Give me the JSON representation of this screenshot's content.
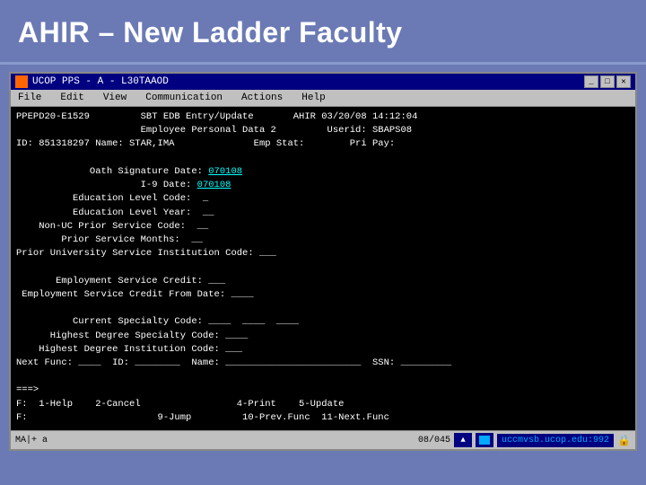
{
  "header": {
    "title": "AHIR – New Ladder Faculty"
  },
  "window": {
    "titlebar": "UCOP PPS - A - L30TAAOD",
    "icon": "app-icon"
  },
  "menubar": {
    "items": [
      "File",
      "Edit",
      "View",
      "Communication",
      "Actions",
      "Help"
    ]
  },
  "terminal": {
    "line1": "PPEPD20-E1529         SBT EDB Entry/Update       AHIR 03/20/08 14:12:04",
    "line2": "                      Employee Personal Data 2         Userid: SBAPS08",
    "line3": "ID: 851318297 Name: STAR,IMA              Emp Stat:        Pri Pay:",
    "line4": "",
    "line5": "             Oath Signature Date: 070108",
    "line6": "                      I-9 Date: 070108",
    "line7": "          Education Level Code:  _",
    "line8": "          Education Level Year:  __",
    "line9": "    Non-UC Prior Service Code:  __",
    "line10": "        Prior Service Months:  __",
    "line11": "Prior University Service Institution Code: ___",
    "line12": "",
    "line13": "       Employment Service Credit: ___",
    "line14": " Employment Service Credit From Date: ____",
    "line15": "",
    "line16": "          Current Specialty Code: ____  ____  ____",
    "line17": "      Highest Degree Specialty Code: ____",
    "line18": "    Highest Degree Institution Code: ___",
    "line19": "Next Func: ____  ID: ________  Name: ________________________  SSN: _________",
    "line20": "",
    "line21": "===>",
    "line22": "F:  1-Help    2-Cancel                 4-Print    5-Update",
    "line23": "F:                       9-Jump         10-Prev.Func  11-Next.Func"
  },
  "statusbar": {
    "left": "MA|+  a",
    "right_counter": "08/045",
    "logo": "uccmvsb.ucop.edu:992"
  },
  "colors": {
    "background": "#6b7ab5",
    "titlebar_bg": "#000080",
    "terminal_bg": "#000000",
    "terminal_fg": "#ffffff",
    "link_color": "#00ffff",
    "window_chrome": "#c0c0c0"
  }
}
